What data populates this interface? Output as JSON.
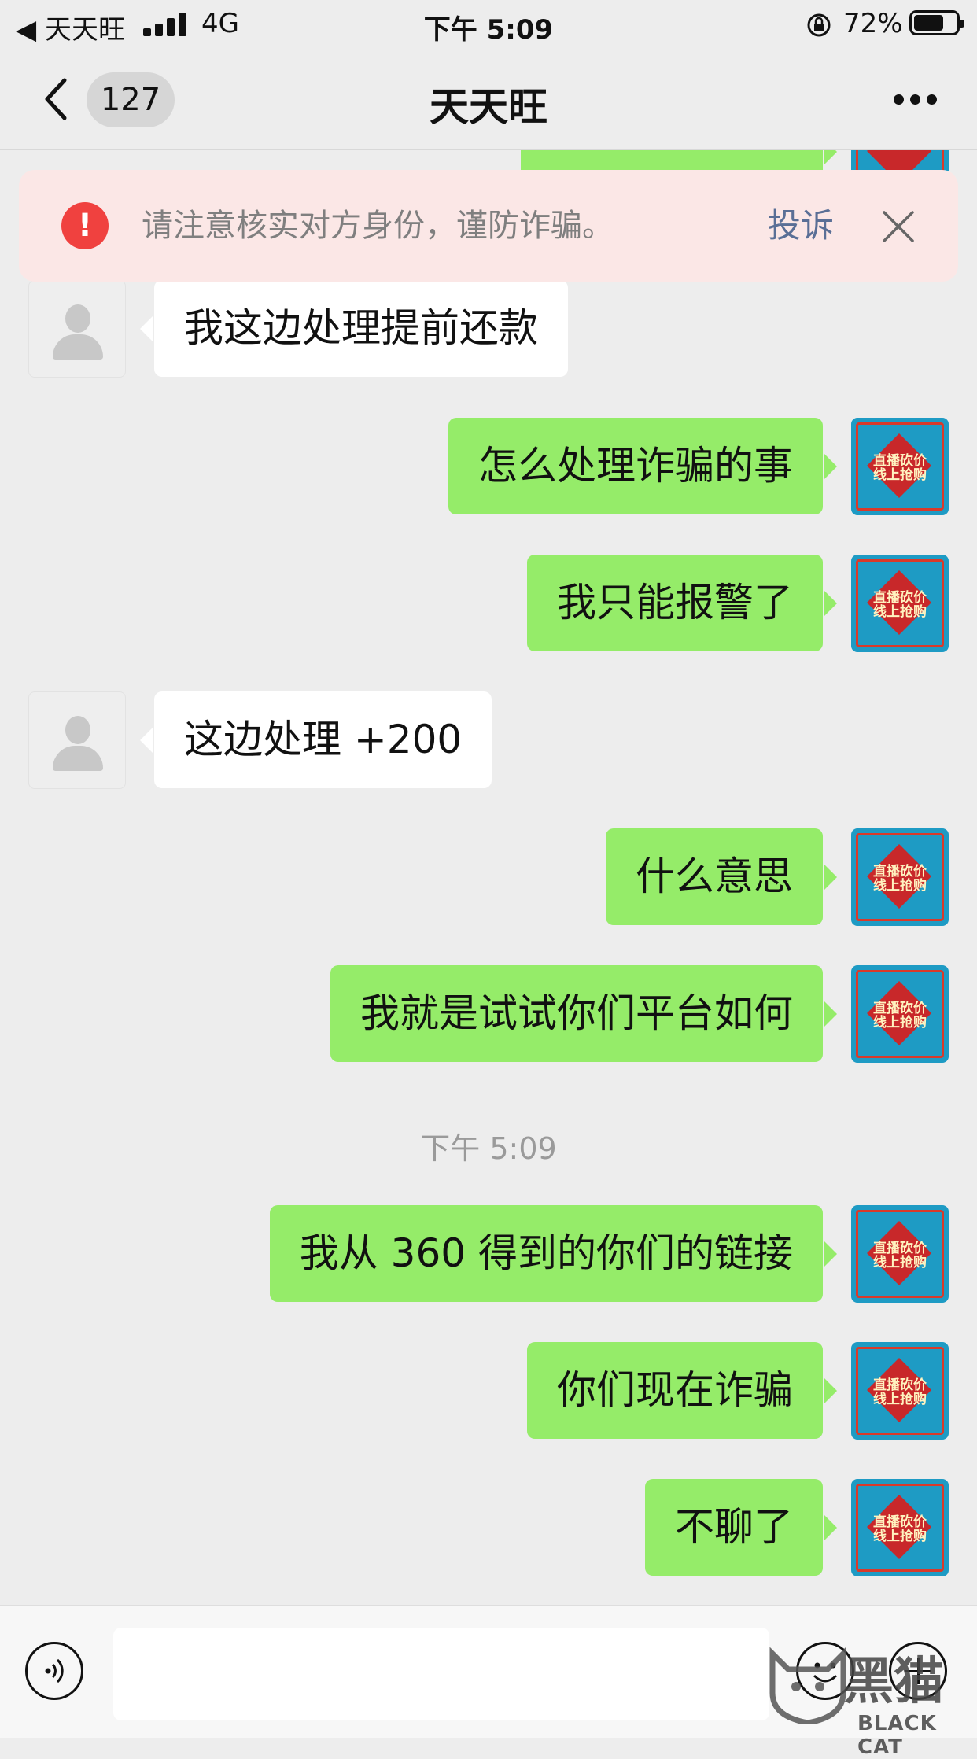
{
  "status_bar": {
    "back_app": "◀ 天天旺",
    "network": "4G",
    "time": "下午 5:09",
    "battery": "72%",
    "battery_level": 0.72
  },
  "nav": {
    "unread_count": "127",
    "title": "天天旺"
  },
  "warning": {
    "text": "请注意核实对方身份，谨防诈骗。",
    "report_label": "投诉"
  },
  "messages": [
    {
      "side": "in",
      "text": "我这边处理提前还款"
    },
    {
      "side": "out",
      "text": "怎么处理诈骗的事"
    },
    {
      "side": "out",
      "text": "我只能报警了"
    },
    {
      "side": "in",
      "text": "这边处理 +200"
    },
    {
      "side": "out",
      "text": "什么意思"
    },
    {
      "side": "out",
      "text": "我就是试试你们平台如何"
    },
    {
      "side": "time",
      "text": "下午 5:09"
    },
    {
      "side": "out",
      "text": "我从 360 得到的你们的链接"
    },
    {
      "side": "out",
      "text": "你们现在诈骗"
    },
    {
      "side": "out",
      "text": "不聊了"
    }
  ],
  "avatar_me_text": "直播砍价 线上抢购",
  "watermark": {
    "cn": "黑猫",
    "en": "BLACK CAT"
  },
  "colors": {
    "outgoing_bubble": "#95ec69",
    "incoming_bubble": "#ffffff",
    "background": "#ededed",
    "warning_bg": "#fbe7e6",
    "warning_icon": "#f0413f",
    "report_link": "#5a6f96"
  }
}
